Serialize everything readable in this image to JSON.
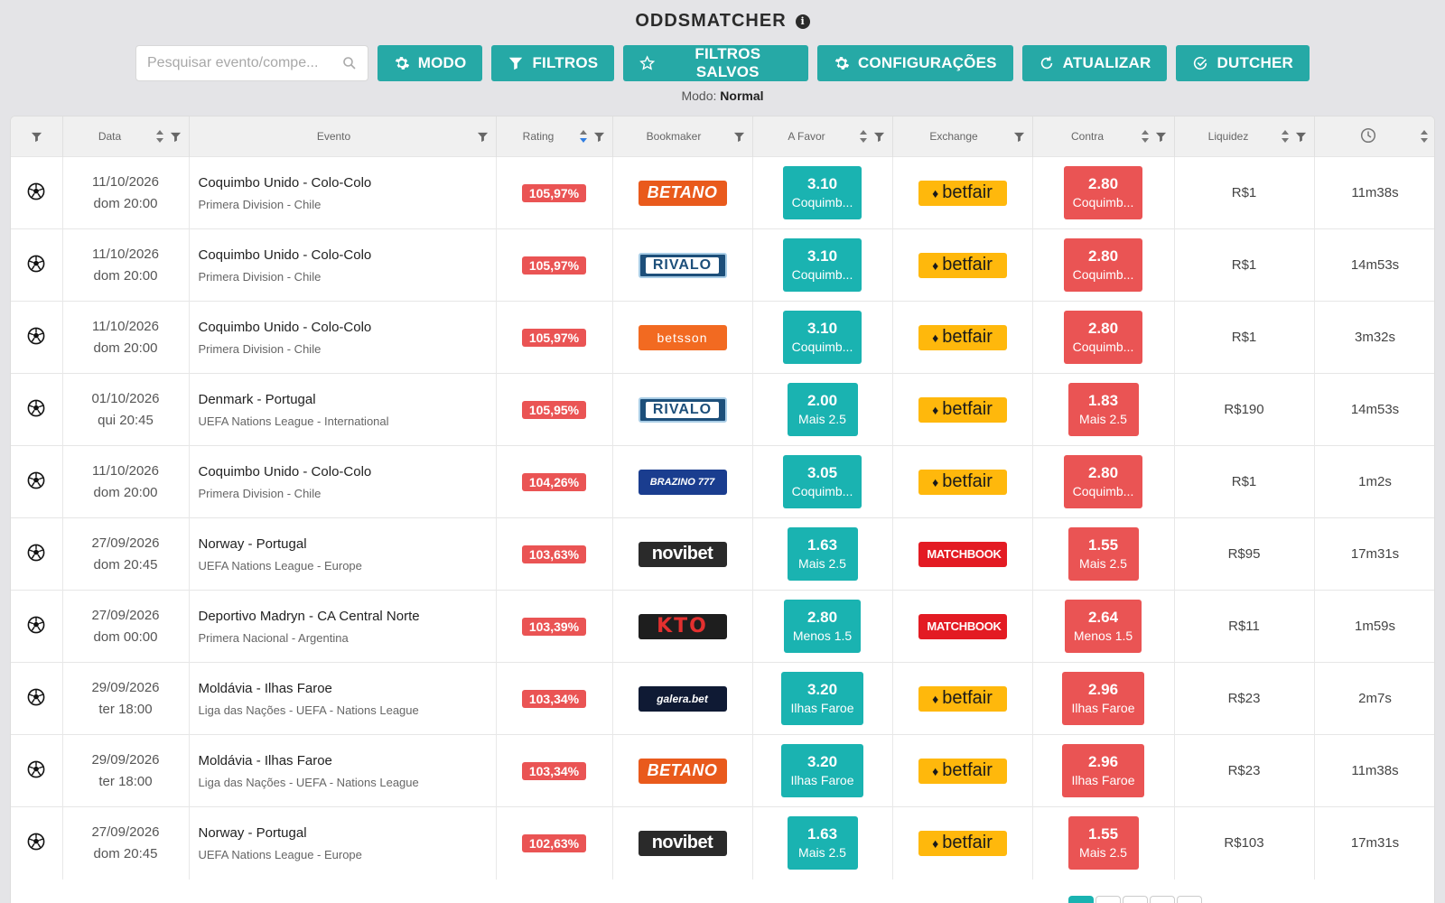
{
  "header": {
    "title": "ODDSMATCHER",
    "info_icon": "info-icon"
  },
  "search": {
    "placeholder": "Pesquisar evento/compe...",
    "value": ""
  },
  "toolbar": {
    "buttons": [
      {
        "label": "MODO",
        "icon": "gear-icon"
      },
      {
        "label": "FILTROS",
        "icon": "filter-icon"
      },
      {
        "label": "FILTROS SALVOS",
        "icon": "star-icon"
      },
      {
        "label": "CONFIGURAÇÕES",
        "icon": "gear-icon"
      },
      {
        "label": "ATUALIZAR",
        "icon": "refresh-icon"
      },
      {
        "label": "DUTCHER",
        "icon": "check-circle-icon"
      }
    ],
    "accent": "#26a9a6"
  },
  "mode": {
    "label": "Modo:",
    "value": "Normal"
  },
  "table": {
    "columns": [
      "",
      "Data",
      "Evento",
      "Rating",
      "Bookmaker",
      "A Favor",
      "Exchange",
      "Contra",
      "Liquidez",
      ""
    ],
    "rows": [
      {
        "date": "11/10/2026",
        "day": "dom 20:00",
        "event": "Coquimbo Unido - Colo-Colo",
        "competition": "Primera Division - Chile",
        "rating": "105,97%",
        "bookmaker": "BETANO",
        "favor_odd": "3.10",
        "favor_sel": "Coquimb...",
        "exchange": "betfair",
        "contra_odd": "2.80",
        "contra_sel": "Coquimb...",
        "liquidity": "R$1",
        "time": "11m38s"
      },
      {
        "date": "11/10/2026",
        "day": "dom 20:00",
        "event": "Coquimbo Unido - Colo-Colo",
        "competition": "Primera Division - Chile",
        "rating": "105,97%",
        "bookmaker": "RIVALO",
        "favor_odd": "3.10",
        "favor_sel": "Coquimb...",
        "exchange": "betfair",
        "contra_odd": "2.80",
        "contra_sel": "Coquimb...",
        "liquidity": "R$1",
        "time": "14m53s"
      },
      {
        "date": "11/10/2026",
        "day": "dom 20:00",
        "event": "Coquimbo Unido - Colo-Colo",
        "competition": "Primera Division - Chile",
        "rating": "105,97%",
        "bookmaker": "betsson",
        "favor_odd": "3.10",
        "favor_sel": "Coquimb...",
        "exchange": "betfair",
        "contra_odd": "2.80",
        "contra_sel": "Coquimb...",
        "liquidity": "R$1",
        "time": "3m32s"
      },
      {
        "date": "01/10/2026",
        "day": "qui 20:45",
        "event": "Denmark - Portugal",
        "competition": "UEFA Nations League - International",
        "rating": "105,95%",
        "bookmaker": "RIVALO",
        "favor_odd": "2.00",
        "favor_sel": "Mais 2.5",
        "exchange": "betfair",
        "contra_odd": "1.83",
        "contra_sel": "Mais 2.5",
        "liquidity": "R$190",
        "time": "14m53s"
      },
      {
        "date": "11/10/2026",
        "day": "dom 20:00",
        "event": "Coquimbo Unido - Colo-Colo",
        "competition": "Primera Division - Chile",
        "rating": "104,26%",
        "bookmaker": "BRAZINO 777",
        "favor_odd": "3.05",
        "favor_sel": "Coquimb...",
        "exchange": "betfair",
        "contra_odd": "2.80",
        "contra_sel": "Coquimb...",
        "liquidity": "R$1",
        "time": "1m2s"
      },
      {
        "date": "27/09/2026",
        "day": "dom 20:45",
        "event": "Norway - Portugal",
        "competition": "UEFA Nations League - Europe",
        "rating": "103,63%",
        "bookmaker": "novibet",
        "favor_odd": "1.63",
        "favor_sel": "Mais 2.5",
        "exchange": "MATCHBOOK",
        "contra_odd": "1.55",
        "contra_sel": "Mais 2.5",
        "liquidity": "R$95",
        "time": "17m31s"
      },
      {
        "date": "27/09/2026",
        "day": "dom 00:00",
        "event": "Deportivo Madryn - CA Central Norte",
        "competition": "Primera Nacional - Argentina",
        "rating": "103,39%",
        "bookmaker": "KTO",
        "favor_odd": "2.80",
        "favor_sel": "Menos 1.5",
        "exchange": "MATCHBOOK",
        "contra_odd": "2.64",
        "contra_sel": "Menos 1.5",
        "liquidity": "R$11",
        "time": "1m59s"
      },
      {
        "date": "29/09/2026",
        "day": "ter 18:00",
        "event": "Moldávia - Ilhas Faroe",
        "competition": "Liga das Nações - UEFA - Nations League",
        "rating": "103,34%",
        "bookmaker": "galera.bet",
        "favor_odd": "3.20",
        "favor_sel": "Ilhas Faroe",
        "exchange": "betfair",
        "contra_odd": "2.96",
        "contra_sel": "Ilhas Faroe",
        "liquidity": "R$23",
        "time": "2m7s"
      },
      {
        "date": "29/09/2026",
        "day": "ter 18:00",
        "event": "Moldávia - Ilhas Faroe",
        "competition": "Liga das Nações - UEFA - Nations League",
        "rating": "103,34%",
        "bookmaker": "BETANO",
        "favor_odd": "3.20",
        "favor_sel": "Ilhas Faroe",
        "exchange": "betfair",
        "contra_odd": "2.96",
        "contra_sel": "Ilhas Faroe",
        "liquidity": "R$23",
        "time": "11m38s"
      },
      {
        "date": "27/09/2026",
        "day": "dom 20:45",
        "event": "Norway - Portugal",
        "competition": "UEFA Nations League - Europe",
        "rating": "102,63%",
        "bookmaker": "novibet",
        "favor_odd": "1.63",
        "favor_sel": "Mais 2.5",
        "exchange": "betfair",
        "contra_odd": "1.55",
        "contra_sel": "Mais 2.5",
        "liquidity": "R$103",
        "time": "17m31s"
      }
    ]
  },
  "colors": {
    "favor": "#1ab3b1",
    "contra": "#ea5454",
    "rating": "#ea5454"
  }
}
